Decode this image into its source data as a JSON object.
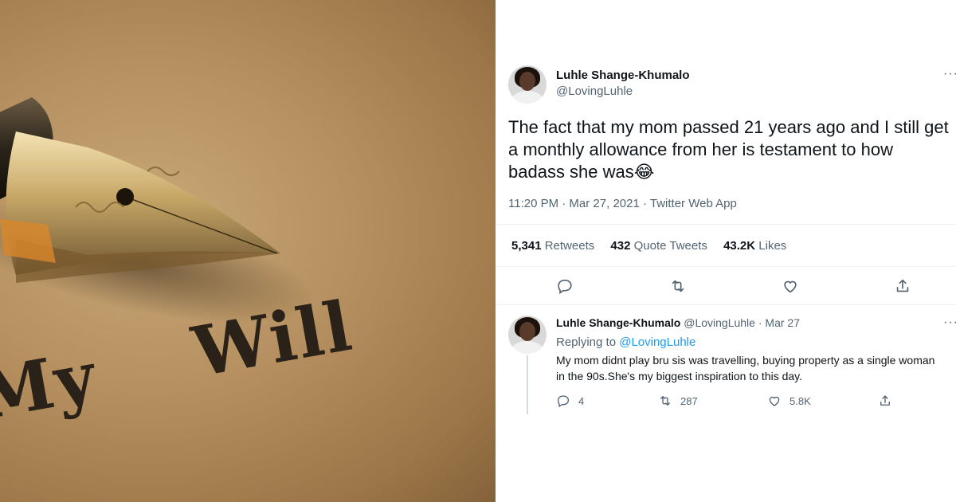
{
  "photo": {
    "caption_words": [
      "My",
      "Will"
    ]
  },
  "tweet": {
    "author_name": "Luhle Shange-Khumalo",
    "author_handle": "@LovingLuhle",
    "more_label": "···",
    "text": "The fact that my mom passed 21 years ago and I still get a monthly allowance from her is testament to how badass she was😂",
    "meta": "11:20 PM · Mar 27, 2021 · Twitter Web App",
    "stats": {
      "retweets_value": "5,341",
      "retweets_label": "Retweets",
      "quotes_value": "432",
      "quotes_label": "Quote Tweets",
      "likes_value": "43.2K",
      "likes_label": "Likes"
    },
    "actions": [
      "reply-icon",
      "retweet-icon",
      "like-icon",
      "share-icon"
    ]
  },
  "reply": {
    "author_name": "Luhle Shange-Khumalo",
    "author_handle": "@LovingLuhle",
    "separator": "·",
    "date": "Mar 27",
    "more_label": "···",
    "replying_prefix": "Replying to",
    "replying_to": "@LovingLuhle",
    "text": "My mom didnt play bru sis was travelling, buying property as a single woman in the 90s.She's my biggest inspiration to this day.",
    "counts": {
      "replies": "4",
      "retweets": "287",
      "likes": "5.8K"
    }
  },
  "colors": {
    "accent": "#1d9bf0",
    "text": "#0f1419",
    "secondary": "#536471",
    "divider": "#eff3f4"
  }
}
